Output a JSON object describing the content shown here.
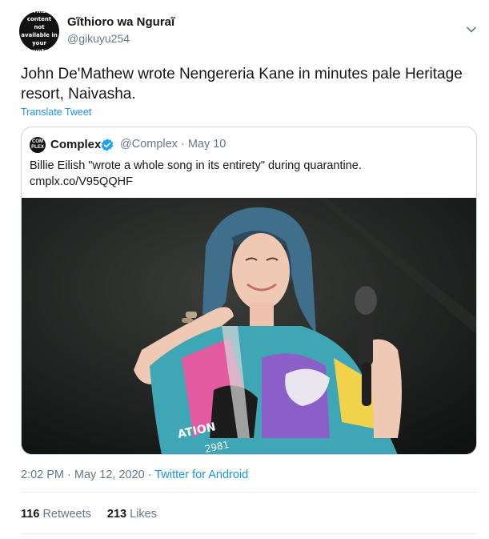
{
  "author": {
    "name": "Gĩthioro wa Ngurаĩ",
    "handle": "@gikuyu254",
    "avatar_text": "This content\nnot available in your\ncountry."
  },
  "tweet": {
    "text": "John De'Mathew wrote Nengereria Kane in minutes pale Heritage resort, Naivasha.",
    "translate_label": "Translate Tweet"
  },
  "quoted": {
    "logo_text": "COM PLEX",
    "name": "Complex",
    "handle_date": "@Complex · May 10",
    "text_line1": "Billie Eilish \"wrote a whole song in its entirety\" during quarantine.",
    "text_line2": "cmplx.co/V95QQHF",
    "photo_shirt_text_1": "ATION",
    "photo_shirt_text_2": "2981"
  },
  "meta": {
    "timestamp": "2:02 PM · May 12, 2020 · ",
    "source": "Twitter for Android"
  },
  "stats": {
    "retweets_count": "116",
    "retweets_label": "Retweets",
    "likes_count": "213",
    "likes_label": "Likes"
  },
  "colors": {
    "link": "#1b95e0",
    "secondary_text": "#657786",
    "verified_badge": "#1da1f2",
    "border": "#ccd6dd"
  },
  "icons": {
    "caret": "chevron-down-icon",
    "verified": "verified-badge-icon"
  }
}
